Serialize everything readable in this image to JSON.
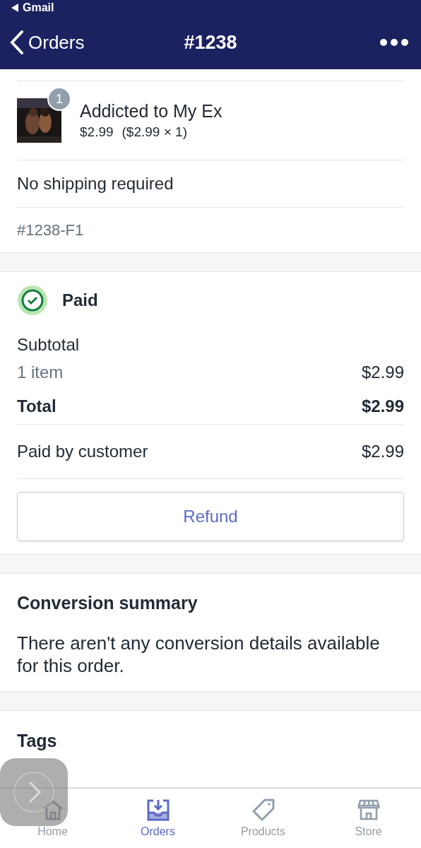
{
  "status_bar": {
    "back_app": "Gmail"
  },
  "nav": {
    "back": "Orders",
    "title": "#1238"
  },
  "line_item": {
    "title": "Addicted to My Ex",
    "price": "$2.99",
    "detail": "($2.99 × 1)",
    "quantity": "1",
    "kind": "picture"
  },
  "shipping": "No shipping required",
  "fulfillment": "#1238-F1",
  "payment": {
    "status": "Paid",
    "subtotal_label": "Subtotal",
    "items": "1 item",
    "items_amount": "$2.99",
    "total_label": "Total",
    "total": "$2.99",
    "paid_label": "Paid by customer",
    "paid": "$2.99",
    "refund": "Refund"
  },
  "conversion": {
    "title": "Conversion summary",
    "text": "There aren't any conversion details available for this order."
  },
  "tags": {
    "title": "Tags"
  },
  "tab_bar": [
    {
      "label": "Home",
      "kind": "home",
      "selected": false
    },
    {
      "label": "Orders",
      "kind": "orders",
      "selected": true
    },
    {
      "label": "Products",
      "kind": "products",
      "selected": false
    },
    {
      "label": "Store",
      "kind": "store",
      "selected": false
    }
  ]
}
